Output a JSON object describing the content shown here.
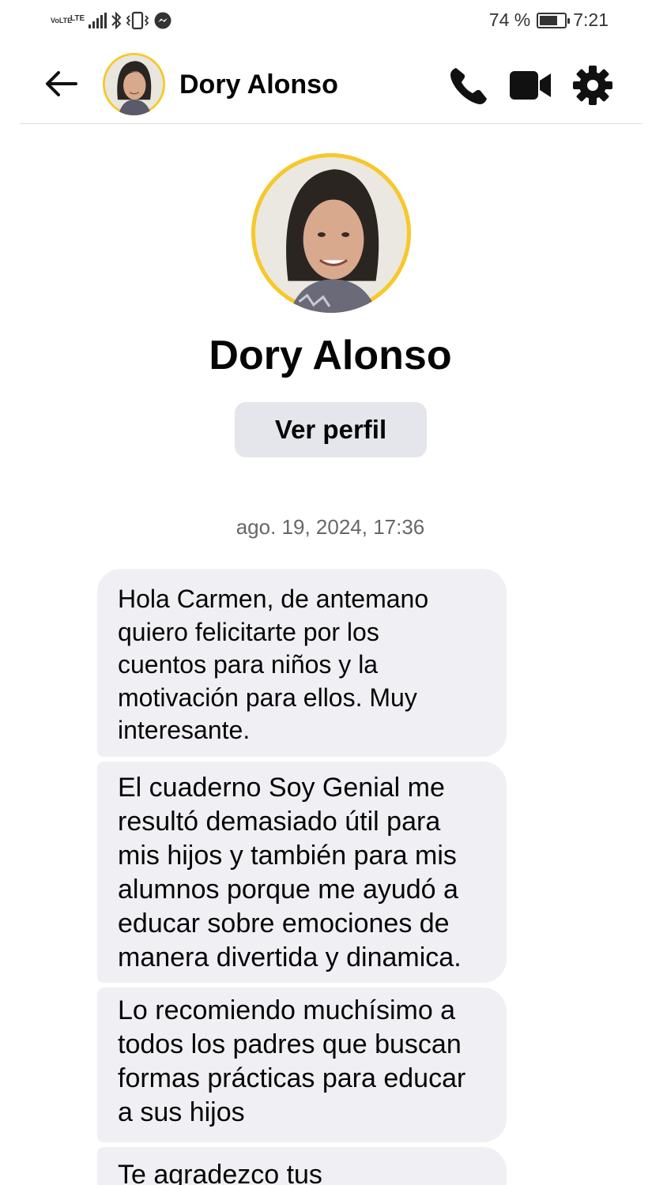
{
  "status_bar": {
    "volte_label": "VoLTE",
    "lte_label": "LTE",
    "battery_percent": "74 %",
    "battery_level": 0.74,
    "time": "7:21",
    "icons": [
      "signal-icon",
      "bluetooth-icon",
      "vibrate-icon",
      "messenger-icon"
    ]
  },
  "header": {
    "contact_name": "Dory Alonso",
    "icons": [
      "back-arrow-icon",
      "phone-icon",
      "video-camera-icon",
      "gear-icon"
    ]
  },
  "profile": {
    "name": "Dory Alonso",
    "view_profile_label": "Ver perfil",
    "avatar_ring_color": "#f7c82b"
  },
  "conversation": {
    "timestamp": "ago. 19, 2024, 17:36",
    "messages": [
      {
        "text": "Hola Carmen, de antemano\nquiero felicitarte por los\ncuentos para niños y la\nmotivación para ellos. Muy\ninteresante."
      },
      {
        "text": "El cuaderno Soy Genial me\nresultó demasiado útil para\nmis hijos y también para mis\nalumnos porque me ayudó a\neducar sobre emociones de\nmanera divertida y dinamica."
      },
      {
        "text": "Lo recomiendo muchísimo a\ntodos los padres que buscan\nformas prácticas para educar\na sus hijos"
      },
      {
        "text": "Te agradezco tus"
      }
    ]
  },
  "colors": {
    "bubble_bg": "#f0f0f4",
    "button_bg": "#e4e6eb",
    "accent_yellow": "#f7c82b",
    "secondary_text": "#65676b"
  }
}
